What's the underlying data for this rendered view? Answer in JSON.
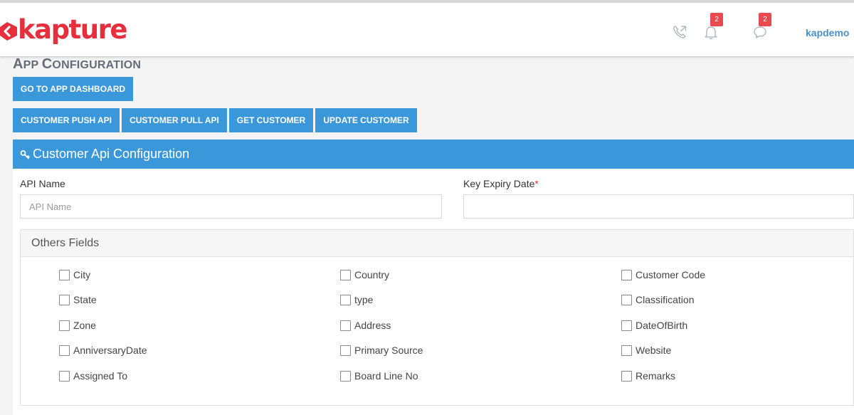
{
  "header": {
    "logo_text": "kapture",
    "username": "kapdemo",
    "notifications_badge": "2",
    "messages_badge": "2",
    "brand_color": "#e62e3c",
    "accent_color": "#3a97da"
  },
  "page": {
    "title_first_letter": "A",
    "title_rest": "PP ",
    "title_second_letter": "C",
    "title_second_rest": "ONFIGURATION",
    "dashboard_button": "GO TO APP DASHBOARD",
    "tabs": [
      "CUSTOMER PUSH API",
      "CUSTOMER PULL API",
      "GET CUSTOMER",
      "UPDATE CUSTOMER"
    ]
  },
  "panel": {
    "title": "Customer Api Configuration",
    "api_name_label": "API Name",
    "api_name_placeholder": "API Name",
    "api_name_value": "",
    "key_expiry_label": "Key Expiry Date",
    "key_expiry_required_mark": "*",
    "key_expiry_value": "",
    "others_title": "Others Fields",
    "fields": [
      [
        "City",
        "Country",
        "Customer Code"
      ],
      [
        "State",
        "type",
        "Classification"
      ],
      [
        "Zone",
        "Address",
        "DateOfBirth"
      ],
      [
        "AnniversaryDate",
        "Primary Source",
        "Website"
      ],
      [
        "Assigned To",
        "Board Line No",
        "Remarks"
      ]
    ]
  }
}
